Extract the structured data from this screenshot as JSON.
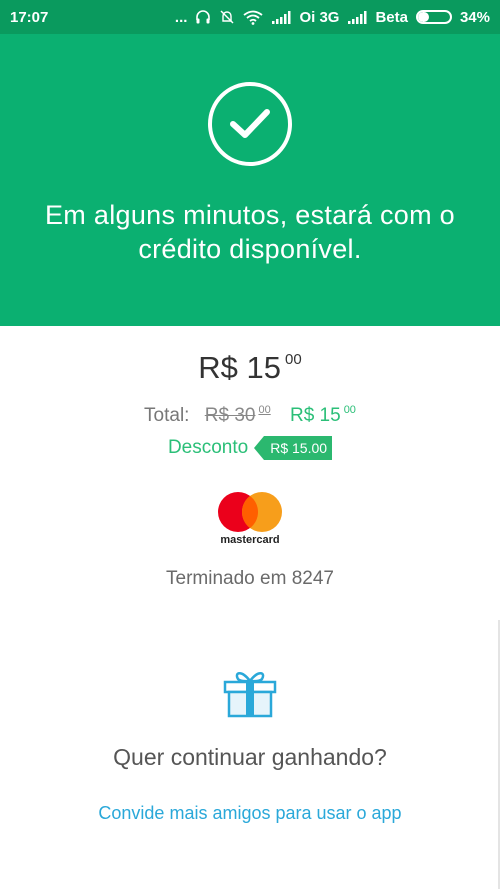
{
  "status_bar": {
    "time": "17:07",
    "dots": "...",
    "carrier1": "Oi 3G",
    "carrier2": "Beta",
    "battery": "34%",
    "battery_level": 0.34,
    "icons": [
      "headphones-icon",
      "notifications-off-icon",
      "wifi-icon",
      "signal-icon",
      "signal-icon",
      "battery-icon"
    ]
  },
  "hero": {
    "message": "Em alguns minutos, estará com o crédito disponível.",
    "icon": "check-icon",
    "bg_color": "#0bb071"
  },
  "price": {
    "currency": "R$",
    "amount": "15",
    "cents": "00"
  },
  "total": {
    "label": "Total:",
    "old_amount": "R$ 30",
    "old_cents": "00",
    "new_amount": "R$ 15",
    "new_cents": "00"
  },
  "discount": {
    "label": "Desconto",
    "value": "R$ 15.00",
    "color": "#2bbf78"
  },
  "card": {
    "brand": "mastercard",
    "ending_text": "Terminado em 8247"
  },
  "promo": {
    "icon": "gift-icon",
    "question": "Quer continuar ganhando?",
    "invite_link": "Convide mais amigos para usar o app",
    "link_color": "#2aa8d9"
  }
}
